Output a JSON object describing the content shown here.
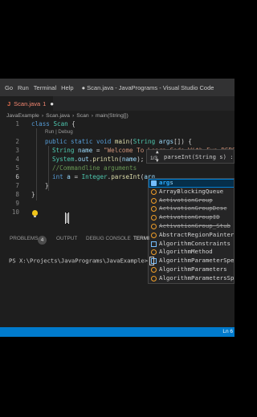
{
  "menu": [
    "Go",
    "Run",
    "Terminal",
    "Help"
  ],
  "window_title": "● Scan.java - JavaPrograms - Visual Studio Code",
  "tab": {
    "icon": "J",
    "label": "Scan.java",
    "suffix": "1",
    "dirty_marker": "●"
  },
  "breadcrumb": [
    "JavaExample",
    "Scan.java",
    "Scan",
    "main(String[])"
  ],
  "breadcrumb_separators": [
    "›",
    "›",
    "›"
  ],
  "codelens": "Run | Debug",
  "code_lines": [
    {
      "num": "1",
      "tokens": [
        [
          "kw",
          "class "
        ],
        [
          "ty",
          "Scan"
        ],
        [
          "pl",
          " {"
        ]
      ]
    },
    {
      "num": "2",
      "tokens": [
        [
          "kw",
          "public static void "
        ],
        [
          "fn",
          "main"
        ],
        [
          "pl",
          "("
        ],
        [
          "ty",
          "String"
        ],
        [
          "pl",
          " "
        ],
        [
          "va",
          "args"
        ],
        [
          "pl",
          "[]) {"
        ]
      ]
    },
    {
      "num": "3",
      "tokens": [
        [
          "ty",
          "String"
        ],
        [
          "pl",
          " "
        ],
        [
          "va",
          "name"
        ],
        [
          "pl",
          " = "
        ],
        [
          "st",
          "\"Welcome To Learn Code With Fun DSRS\";"
        ]
      ]
    },
    {
      "num": "4",
      "tokens": [
        [
          "ty",
          "System"
        ],
        [
          "pl",
          "."
        ],
        [
          "va",
          "out"
        ],
        [
          "pl",
          "."
        ],
        [
          "fn",
          "println"
        ],
        [
          "pl",
          "("
        ],
        [
          "va",
          "name"
        ],
        [
          "pl",
          ");"
        ]
      ]
    },
    {
      "num": "5",
      "tokens": [
        [
          "cm",
          "//Commandline arguments"
        ]
      ]
    },
    {
      "num": "6",
      "tokens": [
        [
          "kw",
          "int"
        ],
        [
          "pl",
          " "
        ],
        [
          "va",
          "a"
        ],
        [
          "pl",
          " = "
        ],
        [
          "ty",
          "Integer"
        ],
        [
          "pl",
          "."
        ],
        [
          "fn",
          "parseInt"
        ],
        [
          "pl",
          "("
        ],
        [
          "va",
          "arg"
        ]
      ]
    },
    {
      "num": "7",
      "tokens": [
        [
          "pl",
          "}"
        ]
      ]
    },
    {
      "num": "8",
      "tokens": [
        [
          "pl",
          "}"
        ]
      ]
    },
    {
      "num": "9",
      "tokens": []
    },
    {
      "num": "10",
      "tokens": []
    }
  ],
  "signature_help": {
    "counter": "1/3",
    "up_arrow": "▲",
    "down_arrow": "▼",
    "signature": "parseInt(String s) :"
  },
  "suggestions": [
    {
      "icon": "variable",
      "label": "args",
      "match": "arg",
      "selected": true,
      "deprecated": false
    },
    {
      "icon": "class",
      "label": "ArrayBlockingQueue",
      "match": "",
      "selected": false,
      "deprecated": false
    },
    {
      "icon": "class",
      "label": "ActivationGroup",
      "match": "",
      "selected": false,
      "deprecated": true
    },
    {
      "icon": "class",
      "label": "ActivationGroupDesc",
      "match": "",
      "selected": false,
      "deprecated": true
    },
    {
      "icon": "class",
      "label": "ActivationGroupID",
      "match": "",
      "selected": false,
      "deprecated": true
    },
    {
      "icon": "class",
      "label": "ActivationGroup_Stub",
      "match": "",
      "selected": false,
      "deprecated": true
    },
    {
      "icon": "class",
      "label": "AbstractRegionPainter",
      "match": "",
      "selected": false,
      "deprecated": false
    },
    {
      "icon": "interface",
      "label": "AlgorithmConstraints",
      "match": "",
      "selected": false,
      "deprecated": false
    },
    {
      "icon": "class",
      "label": "AlgorithmMethod",
      "match": "",
      "selected": false,
      "deprecated": false
    },
    {
      "icon": "interface",
      "label": "AlgorithmParameterSpec",
      "match": "",
      "selected": false,
      "deprecated": false
    },
    {
      "icon": "class",
      "label": "AlgorithmParameters",
      "match": "",
      "selected": false,
      "deprecated": false
    },
    {
      "icon": "class",
      "label": "AlgorithmParametersSpi",
      "match": "",
      "selected": false,
      "deprecated": false
    }
  ],
  "panel": {
    "problems": "PROBLEMS",
    "problems_count": "4",
    "output": "OUTPUT",
    "debug": "DEBUG CONSOLE",
    "terminal": "TERMI"
  },
  "terminal_prompt": "PS X:\\Projects\\JavaPrograms\\JavaExample>",
  "status": {
    "right": "Ln 6"
  },
  "colors": {
    "editor_bg": "#1e1e1e",
    "statusbar": "#007acc",
    "keyword": "#569cd6",
    "type": "#4ec9b0",
    "string": "#ce9178",
    "comment": "#6a9955"
  }
}
